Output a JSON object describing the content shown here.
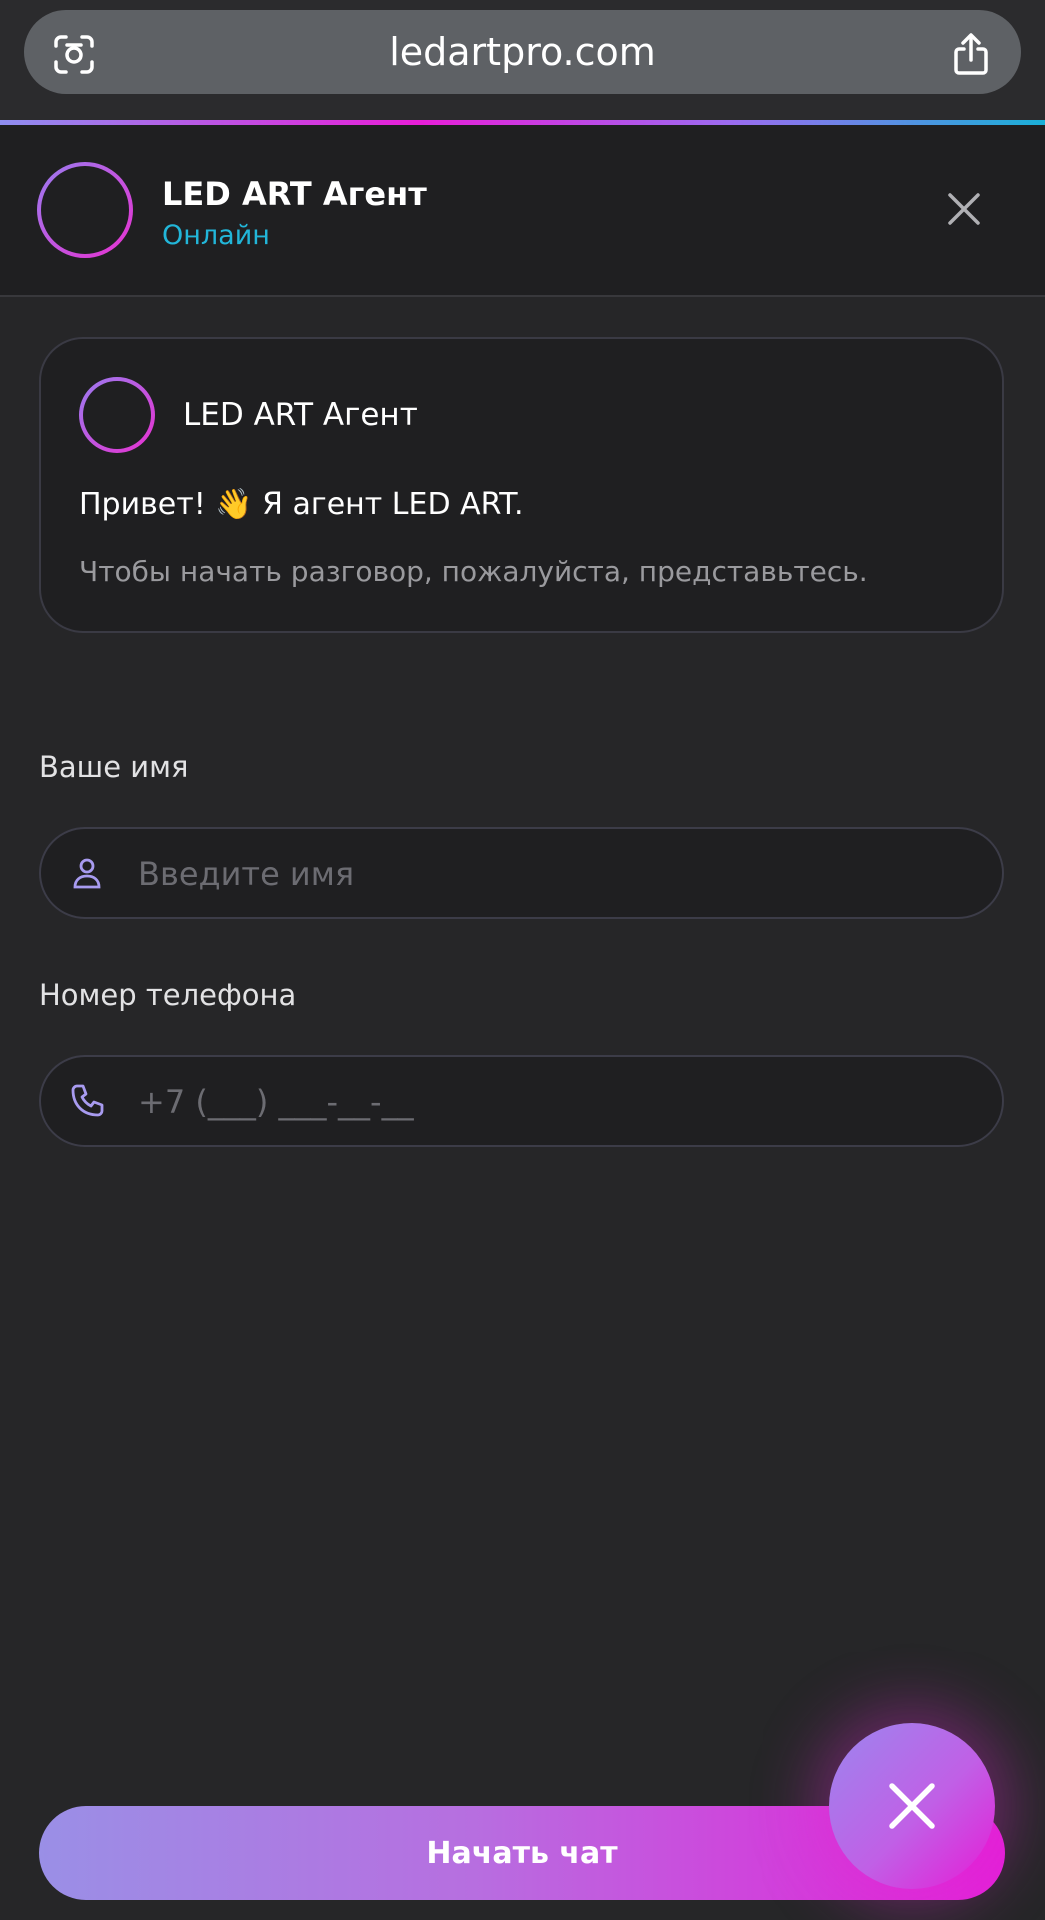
{
  "browser": {
    "url": "ledartpro.com",
    "left_icon": "camera-search-icon",
    "right_icon": "share-icon"
  },
  "header": {
    "title": "LED ART Агент",
    "status": "Онлайн",
    "close_icon": "close-icon"
  },
  "welcome_card": {
    "title": "LED ART Агент",
    "greeting": "Привет! 👋 Я агент LED ART.",
    "subtitle": "Чтобы начать разговор, пожалуйста, представьтесь."
  },
  "form": {
    "name_label": "Ваше имя",
    "name_placeholder": "Введите имя",
    "name_icon": "user-icon",
    "phone_label": "Номер телефона",
    "phone_placeholder": "+7 (___) ___-__-__",
    "phone_icon": "phone-icon"
  },
  "actions": {
    "start_label": "Начать чат",
    "fab_icon": "close-icon"
  },
  "colors": {
    "accent_cyan": "#22b6d9",
    "accent_magenta": "#e41fd8",
    "accent_violet": "#9a8fe6",
    "background": "#262628"
  }
}
